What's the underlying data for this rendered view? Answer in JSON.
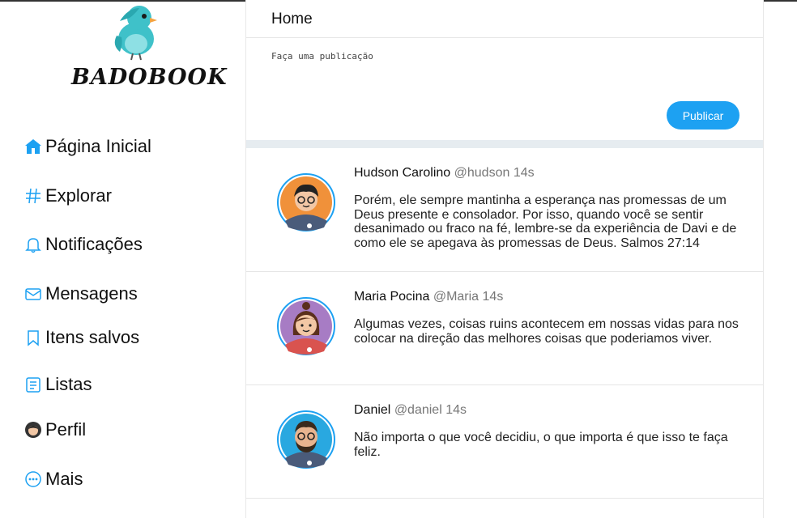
{
  "app": {
    "logo_text": "BADOBOOK"
  },
  "sidebar": {
    "items": [
      {
        "label": "Página Inicial",
        "icon": "home-icon"
      },
      {
        "label": "Explorar",
        "icon": "hashtag-icon"
      },
      {
        "label": "Notificações",
        "icon": "bell-icon"
      },
      {
        "label": "Mensagens",
        "icon": "mail-icon"
      },
      {
        "label": "Itens salvos",
        "icon": "bookmark-icon"
      },
      {
        "label": "Listas",
        "icon": "list-icon"
      },
      {
        "label": "Perfil",
        "icon": "profile-avatar-icon"
      },
      {
        "label": "Mais",
        "icon": "more-icon"
      }
    ]
  },
  "header": {
    "title": "Home"
  },
  "composer": {
    "placeholder": "Faça uma publicação",
    "publish_label": "Publicar"
  },
  "posts": [
    {
      "name": "Hudson Carolino",
      "meta": "@hudson 14s",
      "text": "Porém, ele sempre mantinha a esperança nas promessas de um Deus presente e consolador. Por isso, quando você se sentir desanimado ou fraco na fé, lembre-se da experiência de Davi e de como ele se apegava às promessas de Deus. Salmos 27:14",
      "avatar_color": "#f0913a"
    },
    {
      "name": "Maria Pocina",
      "meta": "@Maria 14s",
      "text": "Algumas vezes, coisas ruins acontecem em nossas vidas para nos colocar na direção das melhores coisas que poderiamos viver.",
      "avatar_color": "#a77cc4"
    },
    {
      "name": "Daniel",
      "meta": "@daniel 14s",
      "text": "Não importa o que você decidiu, o que importa é que isso te faça feliz.",
      "avatar_color": "#29a8e0"
    }
  ],
  "colors": {
    "accent": "#1da1f2",
    "divider": "#e6ecf0"
  }
}
